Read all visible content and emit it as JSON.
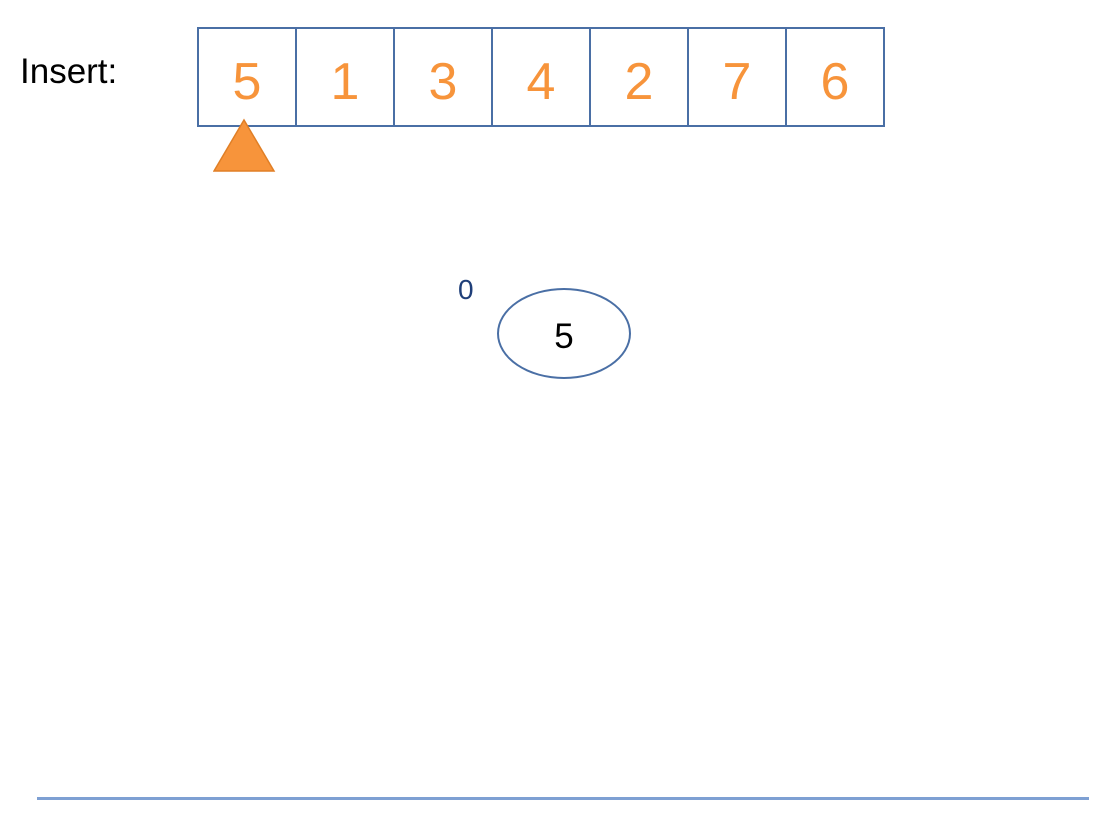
{
  "insert_label": "Insert:",
  "array": {
    "values": [
      "5",
      "1",
      "3",
      "4",
      "2",
      "7",
      "6"
    ],
    "current_index": 0
  },
  "tree": {
    "node": {
      "value": "5",
      "height": "0"
    }
  },
  "colors": {
    "array_text": "#f7943b",
    "box_border": "#4a6fa5",
    "pointer": "#f7943b",
    "height_label": "#1f3f79",
    "footer_rule": "#7ea0d3"
  }
}
